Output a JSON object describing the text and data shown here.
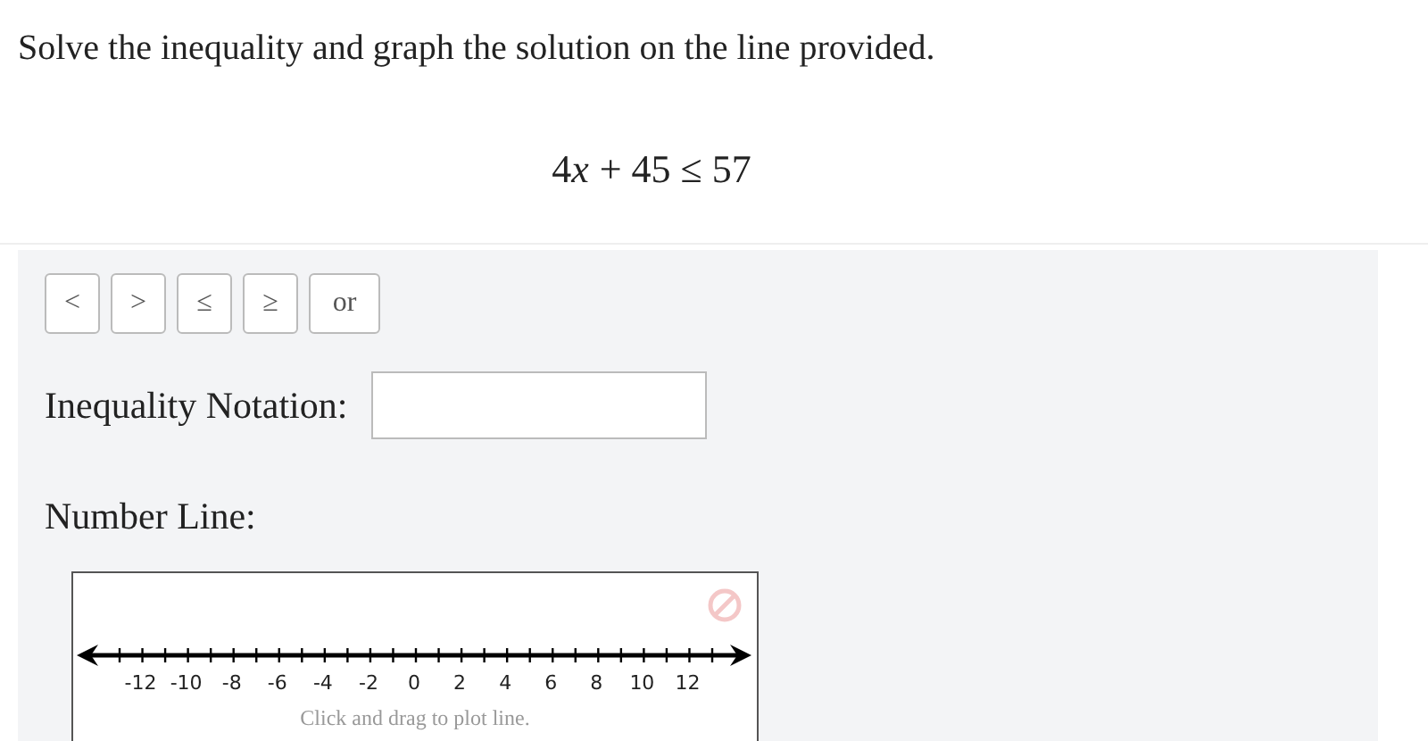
{
  "prompt": "Solve the inequality and graph the solution on the line provided.",
  "equation": [
    {
      "kind": "number",
      "text": "4"
    },
    {
      "kind": "variable",
      "text": "x"
    },
    {
      "kind": "number",
      "text": "+ 45 ≤ 57"
    }
  ],
  "symbol_buttons": [
    "<",
    ">",
    "≤",
    "≥",
    "or"
  ],
  "inequality_notation": {
    "label": "Inequality Notation:"
  },
  "number_line": {
    "label": "Number Line:",
    "tick_labels": [
      "-12",
      "-10",
      "-8",
      "-6",
      "-4",
      "-2",
      "0",
      "2",
      "4",
      "6",
      "8",
      "10",
      "12"
    ],
    "hint": "Click and drag to plot line."
  }
}
